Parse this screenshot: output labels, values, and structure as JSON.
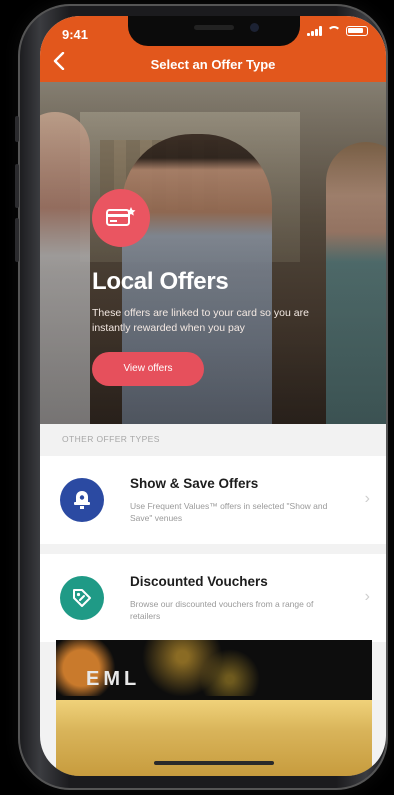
{
  "status_bar": {
    "time": "9:41"
  },
  "header": {
    "title": "Select an Offer Type",
    "back_icon": "chevron-left-icon"
  },
  "hero": {
    "title": "Local Offers",
    "description": "These offers are linked to your card so you are instantly rewarded when you pay",
    "button_label": "View offers",
    "icon": "card-offer-icon",
    "accent_color": "#e6505c"
  },
  "section_label": "OTHER OFFER TYPES",
  "offer_types": [
    {
      "title": "Show & Save Offers",
      "description": "Use Frequent Values™ offers in selected \"Show and Save\" venues",
      "icon": "show-save-icon",
      "color": "#2b4aa2"
    },
    {
      "title": "Discounted Vouchers",
      "description": "Browse our discounted vouchers from a range of retailers",
      "icon": "voucher-tag-icon",
      "color": "#1f9a86"
    }
  ],
  "banner": {
    "logo_text": "EML"
  },
  "colors": {
    "header": "#e2571c"
  }
}
